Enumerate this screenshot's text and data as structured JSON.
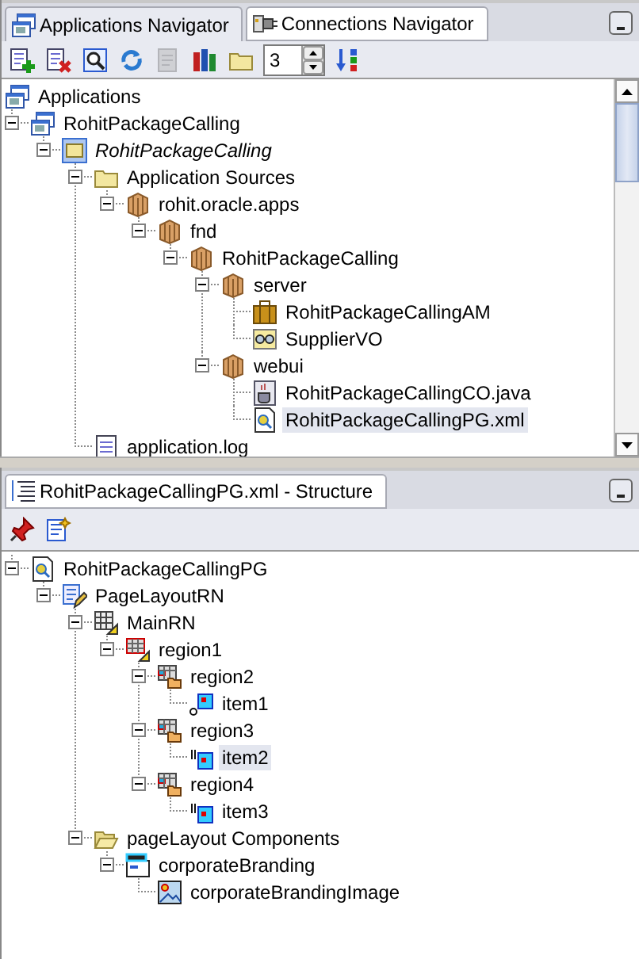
{
  "navigator": {
    "tabs": [
      {
        "label": "Applications Navigator",
        "kind": "workspace",
        "selected": true
      },
      {
        "label": "Connections Navigator",
        "kind": "plug",
        "selected": false
      }
    ],
    "toolbar": {
      "tools": [
        {
          "kind": "add",
          "disabled": false
        },
        {
          "kind": "delete",
          "disabled": false
        },
        {
          "kind": "search",
          "disabled": false
        },
        {
          "kind": "refresh",
          "disabled": false
        },
        {
          "kind": "doc",
          "disabled": true
        },
        {
          "kind": "books",
          "disabled": false
        },
        {
          "kind": "folder",
          "disabled": false
        }
      ],
      "spinner_value": "3"
    },
    "tree": {
      "root": {
        "label": "Applications",
        "kind": "workspace"
      },
      "nodes": [
        {
          "label": "RohitPackageCalling",
          "kind": "workspace",
          "expanded": true,
          "selected": false,
          "italic": false,
          "children": [
            {
              "label": "RohitPackageCalling",
              "kind": "project",
              "expanded": true,
              "selected": false,
              "italic": true,
              "children": [
                {
                  "label": "Application Sources",
                  "kind": "folder",
                  "expanded": true,
                  "selected": false,
                  "italic": false,
                  "children": [
                    {
                      "label": "rohit.oracle.apps",
                      "kind": "package",
                      "expanded": true,
                      "selected": false,
                      "italic": false,
                      "children": [
                        {
                          "label": "fnd",
                          "kind": "package",
                          "expanded": true,
                          "selected": false,
                          "italic": false,
                          "children": [
                            {
                              "label": "RohitPackageCalling",
                              "kind": "package",
                              "expanded": true,
                              "selected": false,
                              "italic": false,
                              "children": [
                                {
                                  "label": "server",
                                  "kind": "package",
                                  "expanded": true,
                                  "selected": false,
                                  "italic": false,
                                  "children": [
                                    {
                                      "label": "RohitPackageCallingAM",
                                      "kind": "briefcase",
                                      "selected": false,
                                      "italic": false
                                    },
                                    {
                                      "label": "SupplierVO",
                                      "kind": "glasses",
                                      "selected": false,
                                      "italic": false
                                    }
                                  ]
                                },
                                {
                                  "label": "webui",
                                  "kind": "package",
                                  "expanded": true,
                                  "selected": false,
                                  "italic": false,
                                  "children": [
                                    {
                                      "label": "RohitPackageCallingCO.java",
                                      "kind": "java",
                                      "selected": false,
                                      "italic": false
                                    },
                                    {
                                      "label": "RohitPackageCallingPG.xml",
                                      "kind": "page",
                                      "selected": true,
                                      "italic": false
                                    }
                                  ]
                                }
                              ]
                            }
                          ]
                        }
                      ]
                    }
                  ]
                },
                {
                  "label": "application.log",
                  "kind": "log",
                  "selected": false,
                  "italic": false
                }
              ]
            }
          ]
        }
      ]
    }
  },
  "structure": {
    "tab": {
      "label": "RohitPackageCallingPG.xml - Structure",
      "kind": "structure"
    },
    "toolbar": {
      "tools": [
        {
          "kind": "pin",
          "disabled": false
        },
        {
          "kind": "new-doc",
          "disabled": false
        }
      ]
    },
    "nodes": [
      {
        "label": "RohitPackageCallingPG",
        "kind": "page",
        "expanded": true,
        "selected": false,
        "italic": false,
        "children": [
          {
            "label": "PageLayoutRN",
            "kind": "layout",
            "expanded": true,
            "selected": false,
            "italic": false,
            "children": [
              {
                "label": "MainRN",
                "kind": "grid",
                "expanded": true,
                "selected": false,
                "italic": false,
                "children": [
                  {
                    "label": "region1",
                    "kind": "region",
                    "expanded": true,
                    "selected": false,
                    "italic": false,
                    "children": [
                      {
                        "label": "region2",
                        "kind": "region-folder",
                        "expanded": true,
                        "selected": false,
                        "italic": false,
                        "children": [
                          {
                            "label": "item1",
                            "kind": "item-image",
                            "selected": false,
                            "italic": false
                          }
                        ]
                      },
                      {
                        "label": "region3",
                        "kind": "region-folder",
                        "expanded": true,
                        "selected": false,
                        "italic": false,
                        "children": [
                          {
                            "label": "item2",
                            "kind": "item-text",
                            "selected": true,
                            "italic": false
                          }
                        ]
                      },
                      {
                        "label": "region4",
                        "kind": "region-folder",
                        "expanded": true,
                        "selected": false,
                        "italic": false,
                        "children": [
                          {
                            "label": "item3",
                            "kind": "item-text",
                            "selected": false,
                            "italic": false
                          }
                        ]
                      }
                    ]
                  }
                ]
              },
              {
                "label": "pageLayout Components",
                "kind": "folder-open",
                "expanded": true,
                "selected": false,
                "italic": false,
                "children": [
                  {
                    "label": "corporateBranding",
                    "kind": "branding",
                    "expanded": true,
                    "selected": false,
                    "italic": false,
                    "children": [
                      {
                        "label": "corporateBrandingImage",
                        "kind": "image",
                        "selected": false,
                        "italic": false
                      }
                    ]
                  }
                ]
              }
            ]
          }
        ]
      }
    ]
  }
}
